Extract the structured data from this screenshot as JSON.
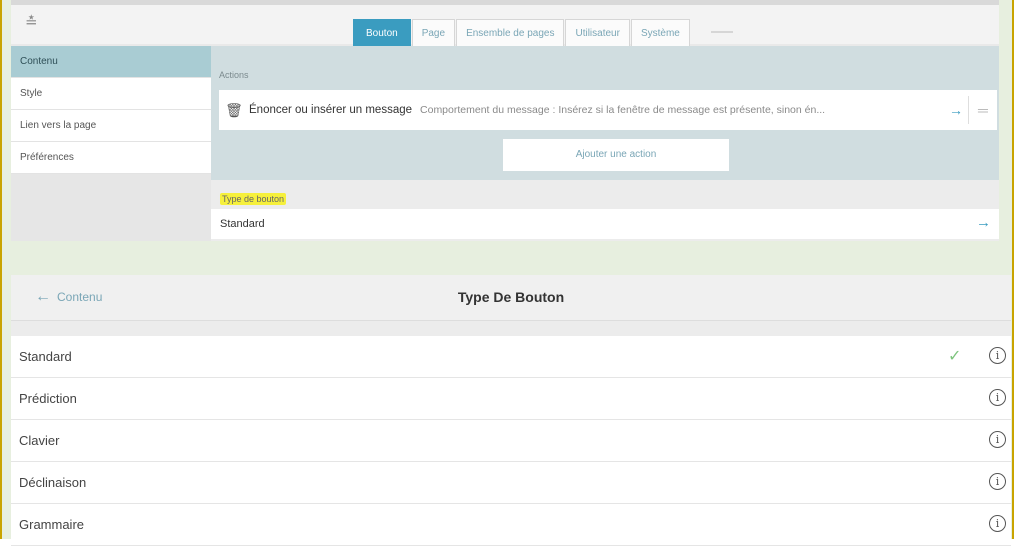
{
  "topbar": {
    "tabs": [
      "Bouton",
      "Page",
      "Ensemble de pages",
      "Utilisateur",
      "Système"
    ],
    "active_tab": "Bouton"
  },
  "sidebar": {
    "items": [
      "Contenu",
      "Style",
      "Lien vers la page",
      "Préférences"
    ],
    "active_item": "Contenu"
  },
  "actions": {
    "label": "Actions",
    "items": [
      {
        "title": "Énoncer ou insérer un message",
        "description": "Comportement du message : Insérez si la fenêtre de message est présente, sinon én..."
      }
    ],
    "add_label": "Ajouter une action"
  },
  "button_type": {
    "label": "Type de bouton",
    "value": "Standard"
  },
  "settings_panel": {
    "back_label": "Contenu",
    "title": "Type De Bouton",
    "options": [
      {
        "label": "Standard",
        "selected": true
      },
      {
        "label": "Prédiction",
        "selected": false
      },
      {
        "label": "Clavier",
        "selected": false
      },
      {
        "label": "Déclinaison",
        "selected": false
      },
      {
        "label": "Grammaire",
        "selected": false
      }
    ]
  },
  "colors": {
    "accent": "#3a9cc0",
    "sidebar_active": "#a9ccd3",
    "highlight": "#f6f03c",
    "check": "#7ec47e",
    "frame_border": "#c9a400"
  },
  "icons": {
    "collapse": "chevron-double-down-icon",
    "trash": "trash-icon",
    "arrow": "arrow-right-icon",
    "menu": "menu-icon",
    "back": "arrow-left-icon",
    "check": "check-icon",
    "info": "info-icon"
  }
}
